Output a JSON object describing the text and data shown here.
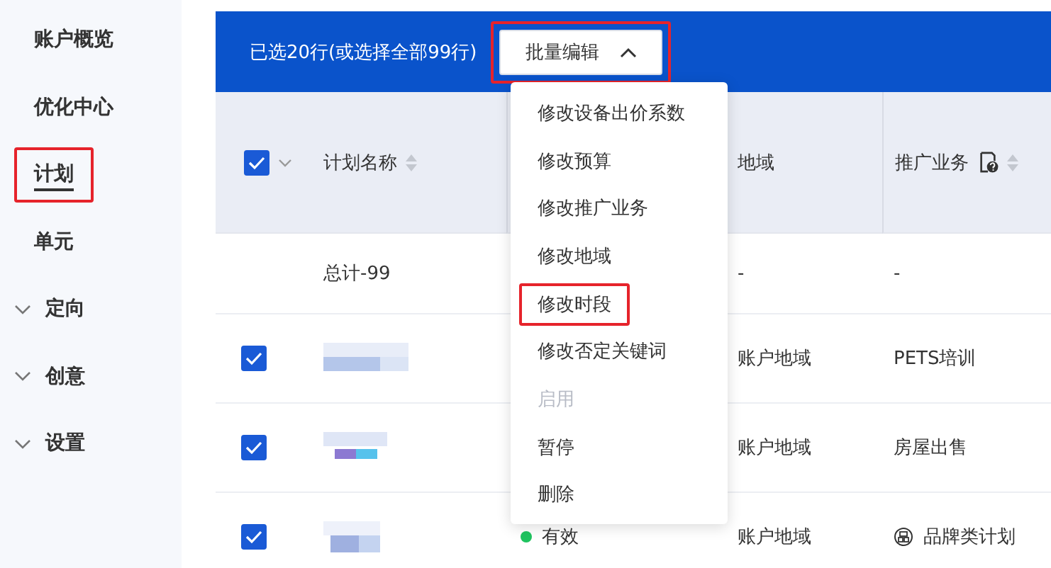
{
  "sidebar": {
    "items": [
      {
        "label": "账户概览",
        "kind": "link",
        "selected": false,
        "highlighted": false
      },
      {
        "label": "优化中心",
        "kind": "link",
        "selected": false,
        "highlighted": false
      },
      {
        "label": "计划",
        "kind": "link",
        "selected": true,
        "highlighted": true
      },
      {
        "label": "单元",
        "kind": "link",
        "selected": false,
        "highlighted": false
      },
      {
        "label": "定向",
        "kind": "group",
        "selected": false,
        "highlighted": false
      },
      {
        "label": "创意",
        "kind": "group",
        "selected": false,
        "highlighted": false
      },
      {
        "label": "设置",
        "kind": "group",
        "selected": false,
        "highlighted": false
      }
    ]
  },
  "selection_bar": {
    "text": "已选20行(或选择全部99行)",
    "batch_button": {
      "label": "批量编辑",
      "expanded": true,
      "highlighted": true
    }
  },
  "batch_menu": {
    "items": [
      {
        "label": "修改设备出价系数",
        "disabled": false,
        "highlighted": false
      },
      {
        "label": "修改预算",
        "disabled": false,
        "highlighted": false
      },
      {
        "label": "修改推广业务",
        "disabled": false,
        "highlighted": false
      },
      {
        "label": "修改地域",
        "disabled": false,
        "highlighted": false
      },
      {
        "label": "修改时段",
        "disabled": false,
        "highlighted": true
      },
      {
        "label": "修改否定关键词",
        "disabled": false,
        "highlighted": false
      },
      {
        "label": "启用",
        "disabled": true,
        "highlighted": false
      },
      {
        "label": "暂停",
        "disabled": false,
        "highlighted": false
      },
      {
        "label": "删除",
        "disabled": false,
        "highlighted": false
      }
    ]
  },
  "table": {
    "select_all": {
      "checked": true
    },
    "columns": [
      {
        "label": "计划名称",
        "sortable": true,
        "help": false
      },
      {
        "label": "地域",
        "sortable": false,
        "help": false
      },
      {
        "label": "推广业务",
        "sortable": true,
        "help": true
      }
    ],
    "rows": [
      {
        "kind": "total",
        "name": "总计-99",
        "region": "-",
        "business": "-"
      },
      {
        "kind": "plan",
        "checked": true,
        "region": "账户地域",
        "business": "PETS培训"
      },
      {
        "kind": "plan",
        "checked": true,
        "region": "账户地域",
        "business": "房屋出售"
      },
      {
        "kind": "plan",
        "checked": true,
        "status": "有效",
        "color": "#1fc35f",
        "region": "账户地域",
        "business": "品牌类计划",
        "brand": true
      }
    ]
  }
}
